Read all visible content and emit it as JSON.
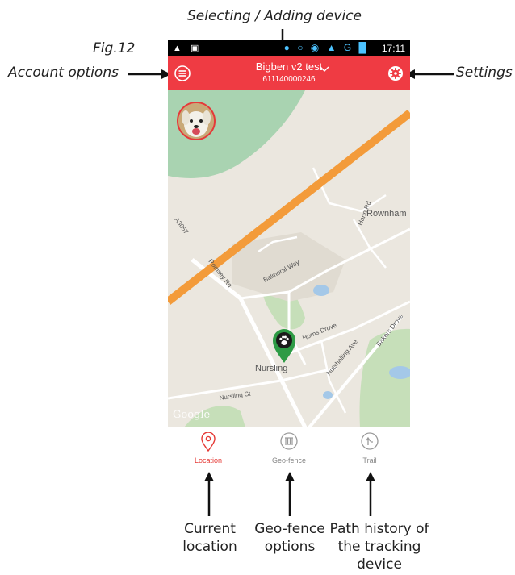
{
  "annotations": {
    "top_label": "Selecting / Adding device",
    "fig_label": "Fig.12",
    "left_label": "Account options",
    "right_label": "Settings",
    "bottom_captions": [
      "Current\nlocation",
      "Geo-fence\noptions",
      "Path history of\nthe tracking\ndevice"
    ]
  },
  "status_bar": {
    "time": "17:11"
  },
  "app_bar": {
    "device_name": "Bigben v2 test",
    "device_number": "611140000246",
    "menu_icon": "hamburger-icon",
    "settings_icon": "gear-icon"
  },
  "map": {
    "labels": {
      "place_rownham": "Rownham",
      "road_a3057": "A3057",
      "road_romsey": "Romsey Rd",
      "road_balmoral": "Balmoral Way",
      "road_hann": "Hann Rd",
      "road_horns": "Horns Drove",
      "road_nutshalling": "Nutshalling Ave",
      "road_bakers": "Bakers Drove",
      "place_nursling": "Nursling",
      "road_nursling_st": "Nursling St"
    },
    "attribution": "Google",
    "marker_icon": "paw-icon"
  },
  "tabs": [
    {
      "label": "Location",
      "icon": "location-pin-icon",
      "active": true
    },
    {
      "label": "Geo-fence",
      "icon": "geofence-icon",
      "active": false
    },
    {
      "label": "Trail",
      "icon": "trail-icon",
      "active": false
    }
  ],
  "colors": {
    "app_bar": "#ef3b43",
    "active_tab": "#e53935",
    "marker": "#2e9b45",
    "motorway": "#f39b3a"
  }
}
